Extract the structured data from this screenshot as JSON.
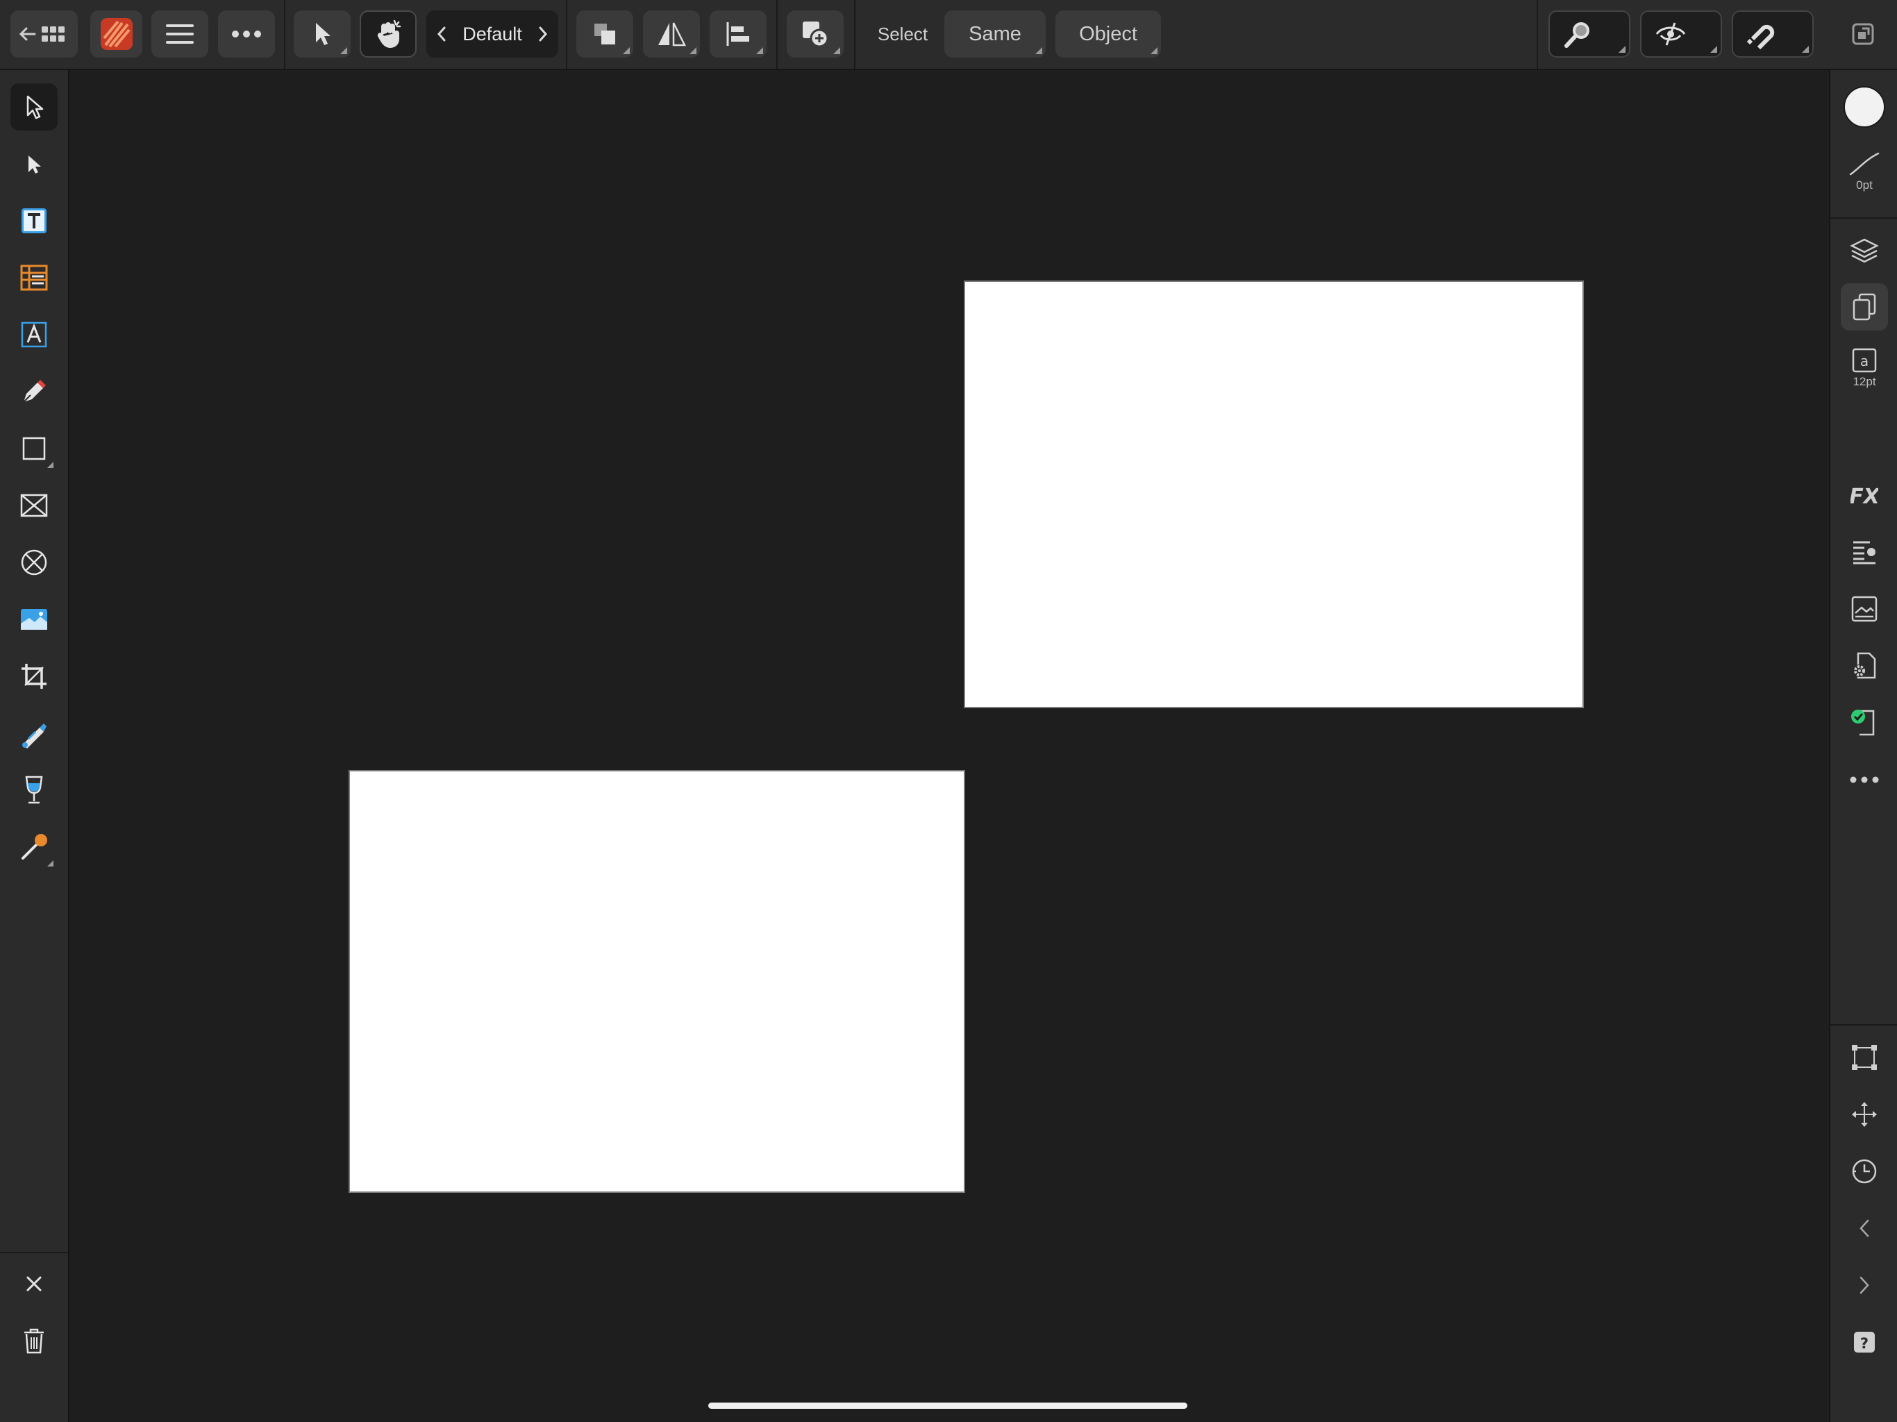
{
  "toolbar": {
    "persona_selector": "Default",
    "select_label": "Select",
    "select_same": "Same",
    "select_object": "Object"
  },
  "left_tools": [
    {
      "name": "move-tool-icon"
    },
    {
      "name": "node-tool-icon"
    },
    {
      "name": "frame-text-tool-icon"
    },
    {
      "name": "table-tool-icon"
    },
    {
      "name": "artistic-text-tool-icon"
    },
    {
      "name": "pen-tool-icon"
    },
    {
      "name": "rectangle-tool-icon"
    },
    {
      "name": "picture-frame-tool-icon"
    },
    {
      "name": "ellipse-frame-tool-icon"
    },
    {
      "name": "place-image-tool-icon"
    },
    {
      "name": "vector-crop-tool-icon"
    },
    {
      "name": "fill-tool-icon"
    },
    {
      "name": "transparency-tool-icon"
    },
    {
      "name": "color-picker-tool-icon"
    }
  ],
  "right_panel": {
    "stroke_width": "0pt",
    "text_size": "12pt"
  },
  "colors": {
    "canvas": "#1e1e1e",
    "panel": "#2b2b2b",
    "page": "#ffffff",
    "accent_orange": "#e8892c",
    "accent_blue": "#3aa0e8",
    "accent_green": "#2ecc71"
  }
}
